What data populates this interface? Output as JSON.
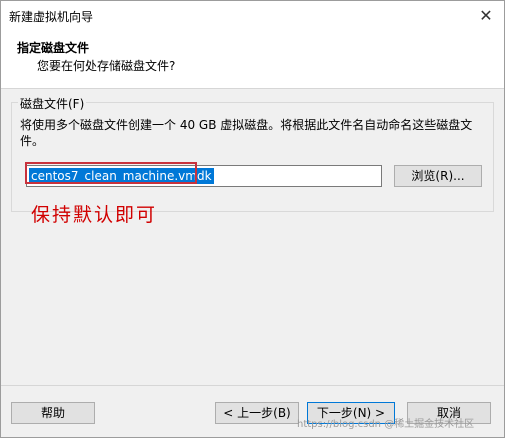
{
  "window": {
    "title": "新建虚拟机向导",
    "close_glyph": "✕"
  },
  "header": {
    "title": "指定磁盘文件",
    "subtitle": "您要在何处存储磁盘文件?"
  },
  "disk_file": {
    "legend": "磁盘文件(F)",
    "description": "将使用多个磁盘文件创建一个 40 GB 虚拟磁盘。将根据此文件名自动命名这些磁盘文件。",
    "value": "centos7_clean_machine.vmdk",
    "browse_label": "浏览(R)..."
  },
  "annotation": {
    "text": "保持默认即可",
    "color": "#d10000"
  },
  "footer": {
    "help_label": "帮助",
    "back_label": "< 上一步(B)",
    "next_label": "下一步(N) >",
    "cancel_label": "取消"
  },
  "watermark": {
    "text": "https://blog.csdn @稀土掘金技术社区"
  },
  "colors": {
    "selection": "#0078d7",
    "highlight_border": "#c8323c",
    "dialog_bg": "#f0f0f0"
  },
  "icons": {
    "close": "close-icon"
  }
}
